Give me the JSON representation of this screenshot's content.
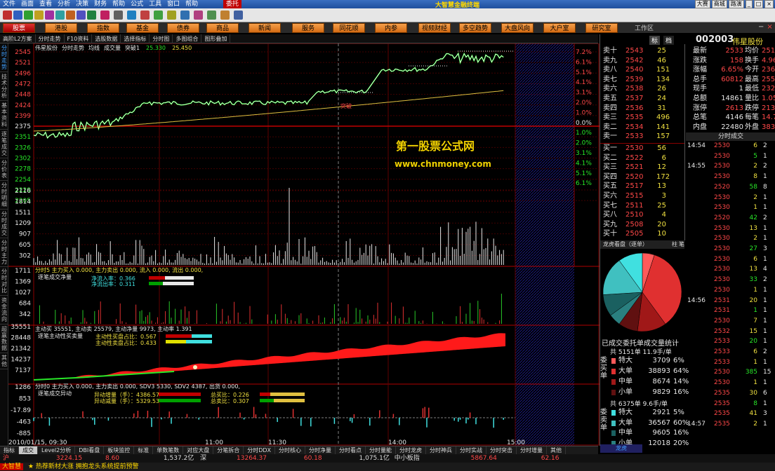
{
  "window": {
    "title": "大智慧金融终端",
    "menus": [
      "文件",
      "画面",
      "查看",
      "分析",
      "决策",
      "财务",
      "帮助",
      "公式",
      "工具",
      "窗口",
      "帮助"
    ],
    "right_tabs": [
      "大赛",
      "商城",
      "路演"
    ],
    "active_menu": "委托"
  },
  "nav": {
    "items": [
      "股票",
      "港股",
      "指数",
      "基金",
      "债券",
      "商品",
      "新闻",
      "服务",
      "同花顺",
      "内参",
      "视频财经",
      "多空趋势",
      "大盘风向标",
      "大户室",
      "研究室"
    ],
    "active": 0,
    "workspace": "工作区"
  },
  "subbar": {
    "items": [
      "高阶L2方案",
      "分时走势",
      "F10资料",
      "选股数据",
      "选择指标",
      "分时图",
      "多图组合",
      "图形叠加"
    ]
  },
  "left_tabs": [
    "分时走势",
    "技术分析",
    "基本资料",
    "逐笔成交",
    "分价表",
    "分时明细",
    "分时成交",
    "分时主力",
    "分时对比",
    "资金流向",
    "超赢数据",
    "其他"
  ],
  "chart": {
    "price_header": {
      "stock": "伟星股份",
      "mode": "分时走势",
      "avg": "均线",
      "vol": "成交量",
      "signal": "突破1",
      "v1": "25.330",
      "v2": "25.450"
    },
    "price_ticks": [
      "2545",
      "2521",
      "2496",
      "2472",
      "2448",
      "2424",
      "2399",
      "2375",
      "2351",
      "2326",
      "2302",
      "2278",
      "2254",
      "2229",
      "2205"
    ],
    "pct_ticks": [
      "7.2%",
      "6.1%",
      "5.1%",
      "4.1%",
      "3.1%",
      "2.0%",
      "1.0%",
      "0.0%",
      "1.0%",
      "2.0%",
      "3.1%",
      "4.1%",
      "5.1%",
      "6.1%"
    ],
    "vol_ticks": [
      "2116",
      "1814",
      "1511",
      "1209",
      "907",
      "605",
      "302"
    ],
    "breakout_label": "突破",
    "watermark_line1": "第一股票公式网",
    "watermark_line2": "www.chnmoney.com",
    "p2": {
      "header": "分时5 主力买入",
      "a": "0.000,",
      "b": "主力卖出",
      "c": "0.000,",
      "d": "流入",
      "e": "0.000,",
      "f": "流出",
      "g": "0.000,",
      "title": "逐笔成交净量",
      "r1": "净流入率：0.366",
      "r2": "净流出率：0.311",
      "ticks": [
        "1711",
        "1369",
        "1027",
        "684",
        "342"
      ]
    },
    "p3": {
      "header": "主动买",
      "v1": "35551",
      "lbl2": "主动卖",
      "v2": "25579",
      "lbl3": "主动净量",
      "v3": "9973",
      "lbl4": "主动率",
      "v4": "1.391",
      "title": "逐笔主动性买卖量",
      "r1": "主动性买盘占比：0.567",
      "r2": "主动性卖盘占比：0.433",
      "ticks": [
        "35551",
        "28448",
        "21342",
        "14237",
        "7137"
      ]
    },
    "p4": {
      "header": "分时0 主力买入",
      "a": "0.000,",
      "b": "主力卖出",
      "c": "0.000,",
      "d": "SDV3",
      "e": "5330,",
      "f": "SDV2",
      "g": "4387,",
      "h": "出货",
      "k": "0.000,",
      "title": "逐笔成交异动",
      "r1": "异动增量（手）：4386.57",
      "r2": "异动减量（手）：5329.53",
      "r3": "总买比：0.226",
      "r4": "总卖比：0.307",
      "ticks": [
        "1286",
        "853",
        "-17.89",
        "-463",
        "-885"
      ]
    },
    "time_labels": [
      "2010/01/15, 09:30",
      "11:00",
      "11:30",
      "14:00",
      "15:00"
    ]
  },
  "bottom_tabs": [
    "指标",
    "成交",
    "Level2分析",
    "DBI看盘",
    "板块监控",
    "标准",
    "单数笔数",
    "对应大盘",
    "分笔拆合",
    "分时DDX",
    "分时核心",
    "分时净量",
    "分时看点",
    "分时量能",
    "分时龙虎",
    "分时神兵",
    "分时实战",
    "分时突击",
    "分时增量",
    "其他"
  ],
  "status": {
    "a": "沪",
    "b": "3224.15",
    "c": "8.60",
    "d": "1,537.2亿",
    "e": "深",
    "f": "13264.37",
    "g": "60.18",
    "h": "1,075.1亿",
    "i": "中小板指",
    "j": "5867.64",
    "k": "62.16"
  },
  "ticker": {
    "tag": "大智慧",
    "text": "★ 热荐新材大涨 拥抱龙头系统提前预警"
  },
  "quote": {
    "code": "002003",
    "name": "伟星股份",
    "tab1": "标",
    "tab2": "档",
    "sells": [
      {
        "l": "卖十",
        "p": "2543",
        "v": "25"
      },
      {
        "l": "卖九",
        "p": "2542",
        "v": "46"
      },
      {
        "l": "卖八",
        "p": "2540",
        "v": "151"
      },
      {
        "l": "卖七",
        "p": "2539",
        "v": "134"
      },
      {
        "l": "卖六",
        "p": "2538",
        "v": "26"
      },
      {
        "l": "卖五",
        "p": "2537",
        "v": "24"
      },
      {
        "l": "卖四",
        "p": "2536",
        "v": "31"
      },
      {
        "l": "卖三",
        "p": "2535",
        "v": "496"
      },
      {
        "l": "卖二",
        "p": "2534",
        "v": "141"
      },
      {
        "l": "卖一",
        "p": "2533",
        "v": "157"
      }
    ],
    "buys": [
      {
        "l": "买一",
        "p": "2530",
        "v": "56"
      },
      {
        "l": "买二",
        "p": "2522",
        "v": "6"
      },
      {
        "l": "买三",
        "p": "2521",
        "v": "12"
      },
      {
        "l": "买四",
        "p": "2520",
        "v": "172"
      },
      {
        "l": "买五",
        "p": "2517",
        "v": "13"
      },
      {
        "l": "买六",
        "p": "2515",
        "v": "3"
      },
      {
        "l": "买七",
        "p": "2511",
        "v": "25"
      },
      {
        "l": "买八",
        "p": "2510",
        "v": "4"
      },
      {
        "l": "买九",
        "p": "2508",
        "v": "20"
      },
      {
        "l": "买十",
        "p": "2505",
        "v": "10"
      }
    ],
    "stats": [
      {
        "a": "最新",
        "b": "2533",
        "c": "均价",
        "d": "2512"
      },
      {
        "a": "涨跌",
        "b": "158",
        "c": "换手",
        "d": "4.96%"
      },
      {
        "a": "涨幅",
        "b": "6.65%",
        "c": "今开",
        "d": "2360"
      },
      {
        "a": "总手",
        "b": "60812",
        "c": "最高",
        "d": "2550"
      },
      {
        "a": "现手",
        "b": "1",
        "c": "最低",
        "d": "2320"
      },
      {
        "a": "总额",
        "b": "14861",
        "c": "量比",
        "d": "1.05"
      },
      {
        "a": "涨停",
        "b": "2613",
        "c": "跌停",
        "d": "2138"
      },
      {
        "a": "总笔",
        "b": "4146",
        "c": "每笔",
        "d": "14.7"
      },
      {
        "a": "内盘",
        "b": "22480",
        "c": "外盘",
        "d": "38332"
      }
    ],
    "ticks_header": "分时成交",
    "ticks": [
      {
        "t": "14:54",
        "p": "2530",
        "v": "6",
        "n": "2"
      },
      {
        "t": "",
        "p": "2530",
        "v": "5",
        "n": "1"
      },
      {
        "t": "14:55",
        "p": "2530",
        "v": "2",
        "n": "2"
      },
      {
        "t": "",
        "p": "2530",
        "v": "8",
        "n": "1"
      },
      {
        "t": "",
        "p": "2520",
        "v": "58",
        "n": "8"
      },
      {
        "t": "",
        "p": "2530",
        "v": "2",
        "n": "1"
      },
      {
        "t": "",
        "p": "2530",
        "v": "1",
        "n": "1"
      },
      {
        "t": "",
        "p": "2520",
        "v": "42",
        "n": "2"
      },
      {
        "t": "",
        "p": "2530",
        "v": "13",
        "n": "1"
      },
      {
        "t": "",
        "p": "2530",
        "v": "2",
        "n": "1"
      },
      {
        "t": "",
        "p": "2530",
        "v": "27",
        "n": "3"
      },
      {
        "t": "",
        "p": "2530",
        "v": "6",
        "n": "1"
      },
      {
        "t": "",
        "p": "2530",
        "v": "13",
        "n": "4"
      },
      {
        "t": "",
        "p": "2530",
        "v": "33",
        "n": "2"
      },
      {
        "t": "",
        "p": "2530",
        "v": "1",
        "n": "1"
      },
      {
        "t": "14:56",
        "p": "2531",
        "v": "20",
        "n": "1"
      },
      {
        "t": "",
        "p": "2531",
        "v": "1",
        "n": "1"
      },
      {
        "t": "",
        "p": "2530",
        "v": "7",
        "n": "1"
      },
      {
        "t": "",
        "p": "2532",
        "v": "15",
        "n": "1"
      },
      {
        "t": "",
        "p": "2533",
        "v": "20",
        "n": "1"
      },
      {
        "t": "",
        "p": "2533",
        "v": "6",
        "n": "2"
      },
      {
        "t": "",
        "p": "2533",
        "v": "1",
        "n": "1"
      },
      {
        "t": "",
        "p": "2530",
        "v": "385",
        "n": "15"
      },
      {
        "t": "",
        "p": "2530",
        "v": "1",
        "n": "1"
      },
      {
        "t": "",
        "p": "2535",
        "v": "30",
        "n": "6"
      },
      {
        "t": "",
        "p": "2535",
        "v": "8",
        "n": "1"
      },
      {
        "t": "",
        "p": "2535",
        "v": "41",
        "n": "3"
      },
      {
        "t": "14:57",
        "p": "2535",
        "v": "2",
        "n": "1"
      }
    ],
    "pie_title": "龙虎看盘（逐单）",
    "pie_tabs": [
      "柱",
      "笔"
    ],
    "pie_slices": [
      {
        "v": 5,
        "c": "#ff5a5a"
      },
      {
        "v": 35,
        "c": "#e03030"
      },
      {
        "v": 12,
        "c": "#a01818"
      },
      {
        "v": 8,
        "c": "#601010"
      },
      {
        "v": 5,
        "c": "#2a8080"
      },
      {
        "v": 9,
        "c": "#1a6060"
      },
      {
        "v": 16,
        "c": "#40c0c0"
      },
      {
        "v": 10,
        "c": "#40e0e0"
      }
    ],
    "order_title": "已成交委托单成交量统计",
    "buy_summary": "共 5151单 11.9手/单",
    "buy_side": "委买单",
    "buy_rows": [
      {
        "n": "特大",
        "v": "3709",
        "p": "6%",
        "c": "#ff5a5a"
      },
      {
        "n": "大单",
        "v": "38893",
        "p": "64%",
        "c": "#e03030"
      },
      {
        "n": "中单",
        "v": "8674",
        "p": "14%",
        "c": "#a01818"
      },
      {
        "n": "小单",
        "v": "9829",
        "p": "16%",
        "c": "#601010"
      }
    ],
    "sell_summary": "共 6375单 9.6手/单",
    "sell_side": "委卖单",
    "sell_rows": [
      {
        "n": "特大",
        "v": "2921",
        "p": "5%",
        "c": "#40e0e0"
      },
      {
        "n": "大单",
        "v": "36567",
        "p": "60%",
        "c": "#40c0c0"
      },
      {
        "n": "中单",
        "v": "9605",
        "p": "16%",
        "c": "#1a6060"
      },
      {
        "n": "小单",
        "v": "12018",
        "p": "20%",
        "c": "#2a8080"
      }
    ],
    "bottom_tab": "龙虎"
  }
}
